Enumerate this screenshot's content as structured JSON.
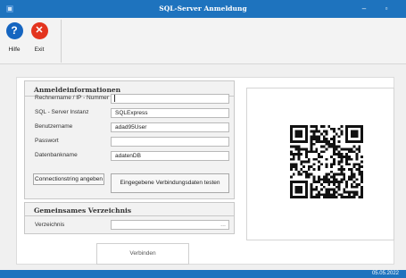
{
  "window": {
    "title": "SQL-Server Anmeldung"
  },
  "toolbar": {
    "help_label": "Hilfe",
    "exit_label": "Exit",
    "help_glyph": "?",
    "exit_glyph": "✕"
  },
  "login": {
    "title": "Anmeldeinformationen",
    "fields": [
      {
        "label": "Rechnername / IP - Nummer",
        "value": ""
      },
      {
        "label": "SQL - Server Instanz",
        "value": "SQLExpress"
      },
      {
        "label": "Benutzername",
        "value": "adad95User"
      },
      {
        "label": "Passwort",
        "value": ""
      },
      {
        "label": "Datenbankname",
        "value": "adatenDB"
      }
    ],
    "connectionstring_button": "Connectionstring angeben",
    "test_button": "Eingegebene Verbindungsdaten testen"
  },
  "shared": {
    "title": "Gemeinsames Verzeichnis",
    "directory_label": "Verzeichnis",
    "directory_value": "",
    "browse_glyph": "..."
  },
  "connect_button": "Verbinden",
  "status": {
    "date": "05.05.2022"
  },
  "colors": {
    "accent": "#1e73be",
    "help": "#1565c0",
    "exit": "#e3341e"
  },
  "icons": {
    "help": "help-icon",
    "exit": "exit-icon",
    "qr": "qr-code-icon"
  }
}
